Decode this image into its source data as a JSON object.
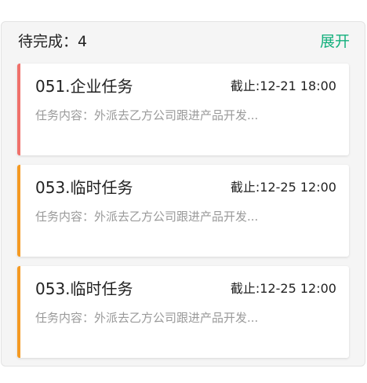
{
  "header": {
    "title": "待完成：4",
    "expand_label": "展开"
  },
  "tasks": [
    {
      "title": "051.企业任务",
      "deadline": "截止:12-21 18:00",
      "description": "任务内容：外派去乙方公司跟进产品开发...",
      "accent_color": "#f0716b"
    },
    {
      "title": "053.临时任务",
      "deadline": "截止:12-25 12:00",
      "description": "任务内容：外派去乙方公司跟进产品开发...",
      "accent_color": "#f59a23"
    },
    {
      "title": "053.临时任务",
      "deadline": "截止:12-25 12:00",
      "description": "任务内容：外派去乙方公司跟进产品开发...",
      "accent_color": "#f59a23"
    }
  ]
}
